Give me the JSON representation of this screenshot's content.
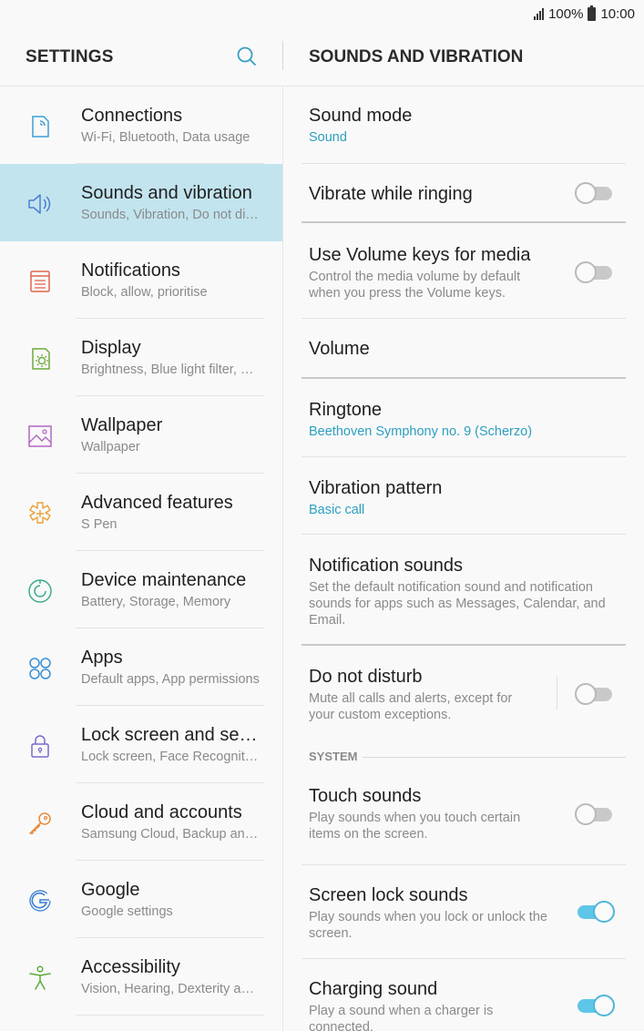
{
  "status_bar": {
    "battery_text": "100%",
    "time": "10:00"
  },
  "left_header": {
    "title": "SETTINGS",
    "search_icon": "search-icon"
  },
  "right_header": {
    "title": "SOUNDS AND VIBRATION"
  },
  "menu": [
    {
      "id": "connections",
      "title": "Connections",
      "subtitle": "Wi-Fi, Bluetooth, Data usage",
      "icon": "connections-icon",
      "color": "#3a9fd6"
    },
    {
      "id": "sounds",
      "title": "Sounds and vibration",
      "subtitle": "Sounds, Vibration, Do not disturb",
      "icon": "speaker-icon",
      "color": "#4a7fd0",
      "selected": true
    },
    {
      "id": "notifications",
      "title": "Notifications",
      "subtitle": "Block, allow, prioritise",
      "icon": "notifications-icon",
      "color": "#e0664f"
    },
    {
      "id": "display",
      "title": "Display",
      "subtitle": "Brightness, Blue light filter, Home screen",
      "icon": "display-icon",
      "color": "#6eab3c"
    },
    {
      "id": "wallpaper",
      "title": "Wallpaper",
      "subtitle": "Wallpaper",
      "icon": "wallpaper-icon",
      "color": "#b267c2"
    },
    {
      "id": "advanced",
      "title": "Advanced features",
      "subtitle": "S Pen",
      "icon": "advanced-features-icon",
      "color": "#e8a13a"
    },
    {
      "id": "maintenance",
      "title": "Device maintenance",
      "subtitle": "Battery, Storage, Memory",
      "icon": "device-maintenance-icon",
      "color": "#3cab8c"
    },
    {
      "id": "apps",
      "title": "Apps",
      "subtitle": "Default apps, App permissions",
      "icon": "apps-icon",
      "color": "#3a8fd6"
    },
    {
      "id": "lockscreen",
      "title": "Lock screen and security",
      "subtitle": "Lock screen, Face Recognition",
      "icon": "lock-icon",
      "color": "#7a6bc9"
    },
    {
      "id": "cloud",
      "title": "Cloud and accounts",
      "subtitle": "Samsung Cloud, Backup and restore",
      "icon": "key-icon",
      "color": "#e8893a"
    },
    {
      "id": "google",
      "title": "Google",
      "subtitle": "Google settings",
      "icon": "google-icon",
      "color": "#3a7fd6"
    },
    {
      "id": "accessibility",
      "title": "Accessibility",
      "subtitle": "Vision, Hearing, Dexterity and interaction",
      "icon": "accessibility-icon",
      "color": "#5cab3c"
    }
  ],
  "settings": {
    "sound_mode": {
      "title": "Sound mode",
      "value": "Sound"
    },
    "vibrate_ringing": {
      "title": "Vibrate while ringing",
      "on": false
    },
    "volume_keys": {
      "title": "Use Volume keys for media",
      "description": "Control the media volume by default when you press the Volume keys.",
      "on": false
    },
    "volume": {
      "title": "Volume"
    },
    "ringtone": {
      "title": "Ringtone",
      "value": "Beethoven Symphony no. 9 (Scherzo)"
    },
    "vibration_pattern": {
      "title": "Vibration pattern",
      "value": "Basic call"
    },
    "notification_sounds": {
      "title": "Notification sounds",
      "description": "Set the default notification sound and notification sounds for apps such as Messages, Calendar, and Email."
    },
    "do_not_disturb": {
      "title": "Do not disturb",
      "description": "Mute all calls and alerts, except for your custom exceptions.",
      "on": false
    },
    "system_header": "SYSTEM",
    "touch_sounds": {
      "title": "Touch sounds",
      "description": "Play sounds when you touch certain items on the screen.",
      "on": false
    },
    "screen_lock_sounds": {
      "title": "Screen lock sounds",
      "description": "Play sounds when you lock or unlock the screen.",
      "on": true
    },
    "charging_sound": {
      "title": "Charging sound",
      "description": "Play a sound when a charger is connected.",
      "on": true
    }
  }
}
